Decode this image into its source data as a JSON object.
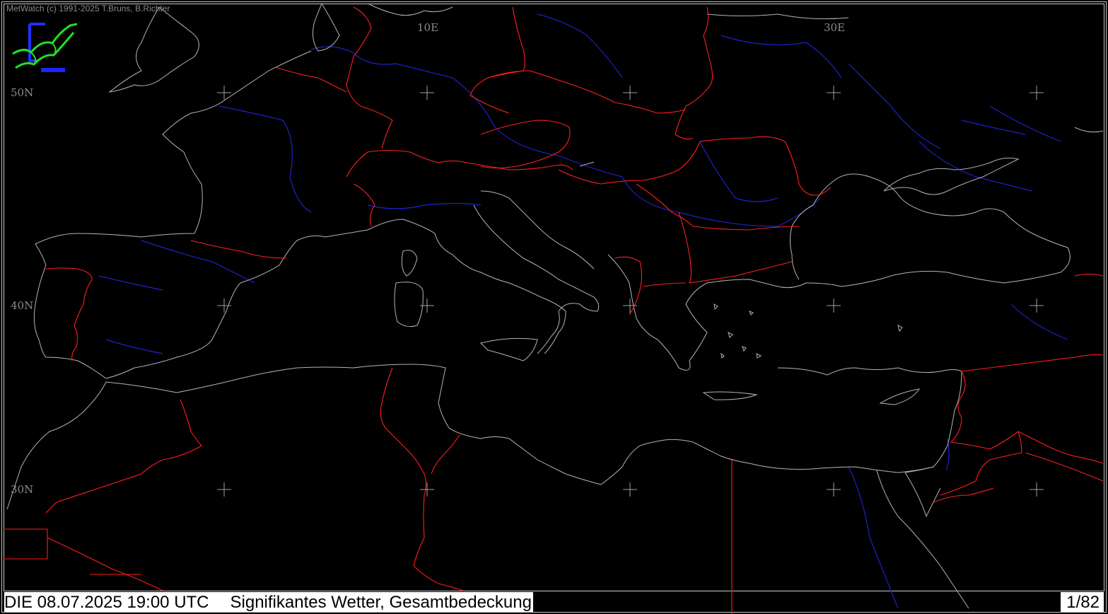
{
  "app": {
    "copyright": "MetWatch  (c) 1991-2025 T.Bruns, B.Richter",
    "logo_icon": "metwatch-logo-icon"
  },
  "map": {
    "longitude_labels": [
      "10E",
      "30E"
    ],
    "latitude_labels": [
      "50N",
      "40N",
      "30N"
    ],
    "colors": {
      "background": "#000000",
      "coastline": "#b4b4b4",
      "border": "#ff1e1e",
      "river": "#1e22c8",
      "grid_cross": "#a0a0a0",
      "label": "#8a8a8a"
    }
  },
  "status": {
    "datetime": "DIE 08.07.2025 19:00 UTC",
    "product": "Signifikantes Wetter, Gesamtbedeckung",
    "page": "1/82"
  }
}
